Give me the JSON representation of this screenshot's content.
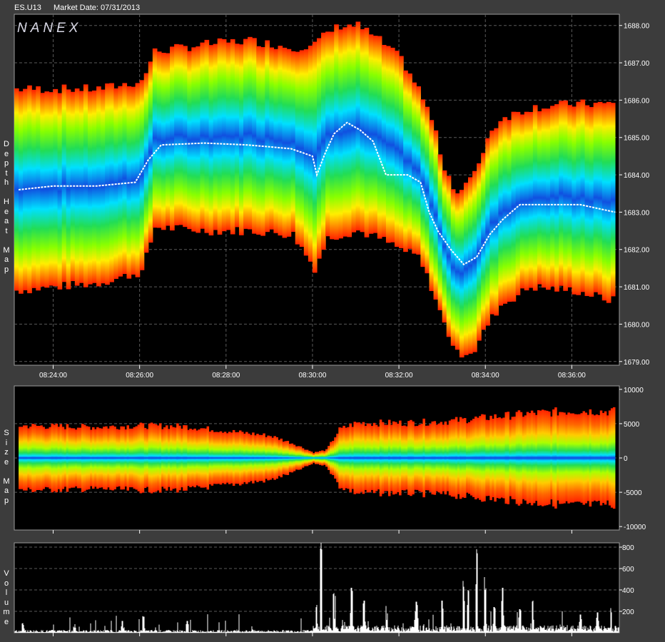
{
  "header": {
    "symbol": "ES.U13",
    "market_date": "Market Date: 07/31/2013"
  },
  "logo": "NANEX",
  "panel_titles": {
    "depth": "Depth Heat Map",
    "size": "Size Map",
    "volume": "Volume"
  },
  "colors": {
    "background": "#000000",
    "frame": "#3c3c3c",
    "grid": "#5a5a5a",
    "price_line": "#ffffff",
    "volume_bar": "#ffffff"
  },
  "chart_data": [
    {
      "type": "heatmap",
      "name_on_chart": "Depth Heat Map",
      "x_ticks": [
        "08:24:00",
        "08:26:00",
        "08:28:00",
        "08:30:00",
        "08:32:00",
        "08:34:00",
        "08:36:00"
      ],
      "x_range_min": [
        23.1,
        37.1
      ],
      "y_ticks": [
        "1688.00",
        "1687.00",
        "1686.00",
        "1685.00",
        "1684.00",
        "1683.00",
        "1682.00",
        "1681.00",
        "1680.00",
        "1679.00"
      ],
      "ylim": [
        1678.9,
        1688.3
      ],
      "price_path": [
        [
          23.2,
          1683.6
        ],
        [
          24.0,
          1683.7
        ],
        [
          25.0,
          1683.7
        ],
        [
          25.9,
          1683.8
        ],
        [
          26.2,
          1684.4
        ],
        [
          26.5,
          1684.8
        ],
        [
          27.5,
          1684.85
        ],
        [
          28.5,
          1684.8
        ],
        [
          29.5,
          1684.7
        ],
        [
          30.0,
          1684.5
        ],
        [
          30.1,
          1684.0
        ],
        [
          30.3,
          1684.6
        ],
        [
          30.5,
          1685.1
        ],
        [
          30.8,
          1685.4
        ],
        [
          31.1,
          1685.2
        ],
        [
          31.4,
          1684.9
        ],
        [
          31.7,
          1684.0
        ],
        [
          32.2,
          1684.0
        ],
        [
          32.5,
          1683.8
        ],
        [
          32.7,
          1683.0
        ],
        [
          32.9,
          1682.5
        ],
        [
          33.2,
          1682.0
        ],
        [
          33.5,
          1681.6
        ],
        [
          33.8,
          1681.8
        ],
        [
          34.1,
          1682.4
        ],
        [
          34.4,
          1682.8
        ],
        [
          34.8,
          1683.2
        ],
        [
          35.5,
          1683.2
        ],
        [
          36.2,
          1683.2
        ],
        [
          37.0,
          1683.0
        ]
      ],
      "bands": [
        [
          23.1,
          1680.9,
          1686.3
        ],
        [
          24.0,
          1681.0,
          1686.3
        ],
        [
          25.0,
          1681.1,
          1686.3
        ],
        [
          26.0,
          1681.4,
          1686.5
        ],
        [
          26.3,
          1682.6,
          1687.3
        ],
        [
          27.5,
          1682.5,
          1687.5
        ],
        [
          28.5,
          1682.5,
          1687.6
        ],
        [
          29.5,
          1682.4,
          1687.4
        ],
        [
          30.0,
          1681.5,
          1687.5
        ],
        [
          30.3,
          1682.3,
          1687.8
        ],
        [
          30.6,
          1682.4,
          1688.0
        ],
        [
          31.0,
          1682.5,
          1688.0
        ],
        [
          31.5,
          1682.3,
          1687.6
        ],
        [
          32.0,
          1682.0,
          1687.1
        ],
        [
          32.4,
          1681.8,
          1686.3
        ],
        [
          32.7,
          1681.0,
          1685.5
        ],
        [
          33.0,
          1680.0,
          1684.2
        ],
        [
          33.3,
          1679.2,
          1683.5
        ],
        [
          33.7,
          1679.3,
          1684.0
        ],
        [
          34.0,
          1680.0,
          1685.0
        ],
        [
          34.3,
          1680.5,
          1685.5
        ],
        [
          35.0,
          1681.0,
          1685.8
        ],
        [
          36.0,
          1680.9,
          1685.9
        ],
        [
          37.0,
          1680.6,
          1685.9
        ]
      ]
    },
    {
      "type": "area",
      "name_on_chart": "Size Map",
      "x_range_min": [
        23.1,
        37.1
      ],
      "y_ticks": [
        "10000",
        "5000",
        "0",
        "-5000",
        "-10000"
      ],
      "ylim": [
        -10500,
        10500
      ],
      "envelope": [
        [
          23.2,
          4800
        ],
        [
          24.0,
          4700
        ],
        [
          25.0,
          4600
        ],
        [
          26.0,
          4800
        ],
        [
          27.0,
          4700
        ],
        [
          28.0,
          4000
        ],
        [
          29.0,
          3300
        ],
        [
          29.5,
          2200
        ],
        [
          30.0,
          800
        ],
        [
          30.3,
          1200
        ],
        [
          30.6,
          4200
        ],
        [
          31.0,
          5200
        ],
        [
          32.0,
          5200
        ],
        [
          33.0,
          5400
        ],
        [
          34.0,
          6000
        ],
        [
          35.0,
          6600
        ],
        [
          36.0,
          7000
        ],
        [
          37.0,
          6900
        ]
      ]
    },
    {
      "type": "bar",
      "name_on_chart": "Volume",
      "x_range_min": [
        23.1,
        37.1
      ],
      "y_ticks": [
        "800",
        "600",
        "400",
        "200"
      ],
      "ylim": [
        0,
        840
      ],
      "peaks": [
        [
          23.3,
          90
        ],
        [
          24.5,
          80
        ],
        [
          25.6,
          110
        ],
        [
          26.1,
          150
        ],
        [
          27.1,
          110
        ],
        [
          28.6,
          60
        ],
        [
          30.1,
          260
        ],
        [
          30.2,
          840
        ],
        [
          30.5,
          370
        ],
        [
          30.9,
          420
        ],
        [
          31.2,
          300
        ],
        [
          31.7,
          250
        ],
        [
          32.4,
          290
        ],
        [
          33.0,
          300
        ],
        [
          33.5,
          430
        ],
        [
          33.6,
          400
        ],
        [
          33.8,
          780
        ],
        [
          34.0,
          400
        ],
        [
          34.2,
          240
        ],
        [
          34.4,
          420
        ],
        [
          34.8,
          220
        ],
        [
          35.1,
          300
        ],
        [
          36.2,
          170
        ],
        [
          36.6,
          190
        ],
        [
          36.9,
          230
        ]
      ]
    }
  ]
}
